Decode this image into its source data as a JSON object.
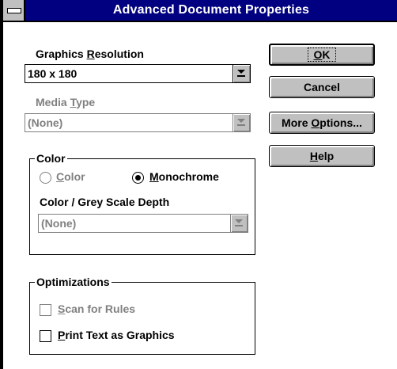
{
  "window": {
    "title": "Advanced Document Properties"
  },
  "graphics_resolution": {
    "label_prefix": "Graphics ",
    "label_accel": "R",
    "label_suffix": "esolution",
    "value": "180 x 180"
  },
  "media_type": {
    "label_prefix": "Media ",
    "label_accel": "T",
    "label_suffix": "ype",
    "value": "(None)"
  },
  "color_group": {
    "title": "Color",
    "color_radio": {
      "accel": "C",
      "rest": "olor",
      "selected": false
    },
    "mono_radio": {
      "accel": "M",
      "rest": "onochrome",
      "selected": true
    },
    "depth_label": "Color / Grey Scale Depth",
    "depth_value": "(None)"
  },
  "optimizations_group": {
    "title": "Optimizations",
    "scan_rules": {
      "accel": "S",
      "rest": "can for Rules",
      "checked": false
    },
    "print_text": {
      "accel": "P",
      "rest": "rint Text as Graphics",
      "checked": false
    }
  },
  "buttons": {
    "ok": {
      "accel": "O",
      "rest": "K"
    },
    "cancel": "Cancel",
    "more_options": {
      "prefix": "More ",
      "accel": "O",
      "rest": "ptions..."
    },
    "help": {
      "accel": "H",
      "rest": "elp"
    }
  },
  "icons": {
    "system_menu": "system-menu-icon",
    "dropdown_arrow": "dropdown-arrow-icon"
  }
}
